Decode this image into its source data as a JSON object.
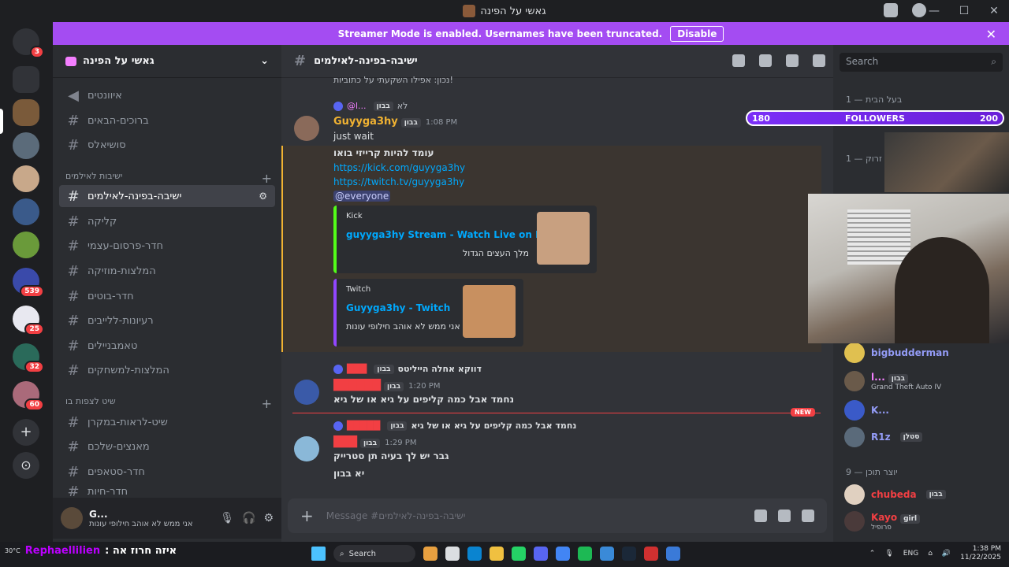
{
  "window": {
    "title": "גאשי על הפינה",
    "controls": [
      "—",
      "☐",
      "✕"
    ]
  },
  "banner": {
    "text": "Streamer Mode is enabled. Usernames have been truncated.",
    "button": "Disable",
    "close": "✕"
  },
  "servers": {
    "top_badge": "3",
    "badges": [
      "539",
      "25",
      "32",
      "60"
    ],
    "add": "+",
    "discover": "⊙"
  },
  "guild": {
    "name": "גאשי על הפינה",
    "chevron": "⌄"
  },
  "channels": {
    "top": [
      "איוונטים",
      "ברוכים-הבאים",
      "סושיאלס"
    ],
    "cat1": "ישיבות לאילמים",
    "cat1_items": [
      "ישיבה-בפינה-לאילמים",
      "קליקה",
      "חדר-פרסום-עצמי",
      "המלצות-מוזיקה",
      "חדר-בוטים",
      "רעיונות-ללייבים",
      "טאמבניילים",
      "המלצות-למשחקים"
    ],
    "cat2": "שיט לצפות בו",
    "cat2_items": [
      "שיט-לראות-במקרן",
      "מאנצים-שלכם",
      "חדר-סטאפים",
      "חדר-חיות"
    ],
    "hash": "#",
    "plus": "+"
  },
  "user": {
    "name": "G...",
    "status": "אני ממש לא אוהב חילופי עונות"
  },
  "chat": {
    "channel": "ישיבה-בפינה-לאילמים",
    "prev_line": "נכון: אפילו השקעתי על כתוביות!",
    "m1": {
      "reply_who": "@l...",
      "reply_tag": "בבון",
      "reply_text": "לא",
      "name": "Guyyga3hy",
      "tag": "בבון",
      "time": "1:08 PM",
      "line1": "just wait",
      "line2": "עומד להיות קרייזי בואו",
      "link1": "https://kick.com/guyyga3hy",
      "link2": "https://twitch.tv/guyyga3hy",
      "mention": "@everyone",
      "embed1": {
        "provider": "Kick",
        "title": "guyyga3hy Stream - Watch Live on Kick",
        "desc": "מלך העצים הגדול"
      },
      "embed2": {
        "provider": "Twitch",
        "title": "Guyyga3hy - Twitch",
        "desc": "אני ממש לא אוהב חילופי עונות"
      }
    },
    "m2": {
      "reply_tag": "בבון",
      "reply_text": "דווקא אחלה הייליטס",
      "tag": "בבון",
      "time": "1:20 PM",
      "text": "נחמד אבל כמה קליפים על גיא או של גיא"
    },
    "new_label": "NEW",
    "m3": {
      "reply_tag": "בבון",
      "reply_text": "נחמד אבל כמה קליפים על גיא או של גיא",
      "tag": "בבון",
      "time": "1:29 PM",
      "line1": "גבר יש לך בעיה תן סטרייק",
      "line2": "יא בבון"
    },
    "placeholder": "Message #ישיבה-בפינה-לאילמים"
  },
  "members": {
    "search": "Search",
    "cat1": "בעל הבית — 1",
    "cat2": "פק זרוק — 1",
    "cat3": "יוצר תוכן — 9",
    "list": [
      {
        "name": "bigbudderman",
        "color": "#949cf7"
      },
      {
        "name": "l...",
        "tag": "בבון",
        "sub": "Grand Theft Auto IV",
        "color": "#f47fff"
      },
      {
        "name": "K...",
        "color": "#949cf7"
      },
      {
        "name": "R1z",
        "tag": "סטלן",
        "color": "#949cf7"
      },
      {
        "name": "chubeda",
        "tag": "בבון",
        "color": "#f23f43"
      },
      {
        "name": "Kayo",
        "tag": "girl",
        "sub": "פרופיל",
        "color": "#f23f43"
      }
    ]
  },
  "overlay": {
    "left": "180",
    "label": "FOLLOWERS",
    "right": "200"
  },
  "taskbar": {
    "weather": "30°C",
    "ticker_name": "Rephaellilien",
    "ticker_text": ": איזה חרוז אה",
    "search": "Search",
    "lang": "ENG",
    "time": "1:38 PM",
    "date": "11/22/2025"
  },
  "colors": {
    "accent": "#a44cf2",
    "link": "#00a8fc",
    "kick": "#53fc18"
  }
}
